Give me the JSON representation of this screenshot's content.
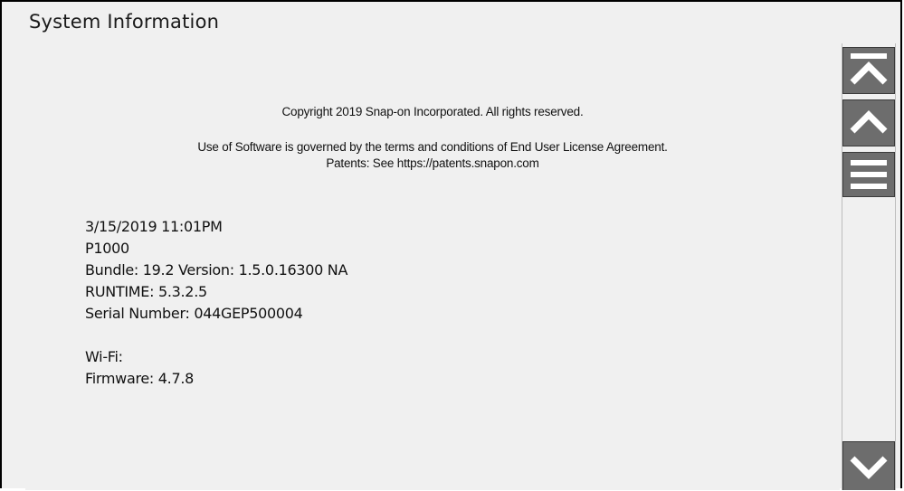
{
  "window": {
    "title": "System Information"
  },
  "legal": {
    "copyright": "Copyright 2019 Snap-on Incorporated. All rights reserved.",
    "license": "Use of Software is governed by the terms and conditions of End User License Agreement.",
    "patents": "Patents: See https://patents.snapon.com"
  },
  "system_info": {
    "datetime": "3/15/2019 11:01PM",
    "model": "P1000",
    "bundle": "Bundle: 19.2 Version: 1.5.0.16300 NA",
    "runtime": "RUNTIME: 5.3.2.5",
    "serial": "Serial Number: 044GEP500004",
    "wifi": "Wi-Fi:",
    "firmware": "Firmware: 4.7.8"
  },
  "scrollbar": {
    "buttons": [
      "scroll-to-top-icon",
      "scroll-up-icon",
      "scroll-thumb-icon",
      "scroll-down-icon"
    ],
    "button_color": "#6d6d6d"
  }
}
